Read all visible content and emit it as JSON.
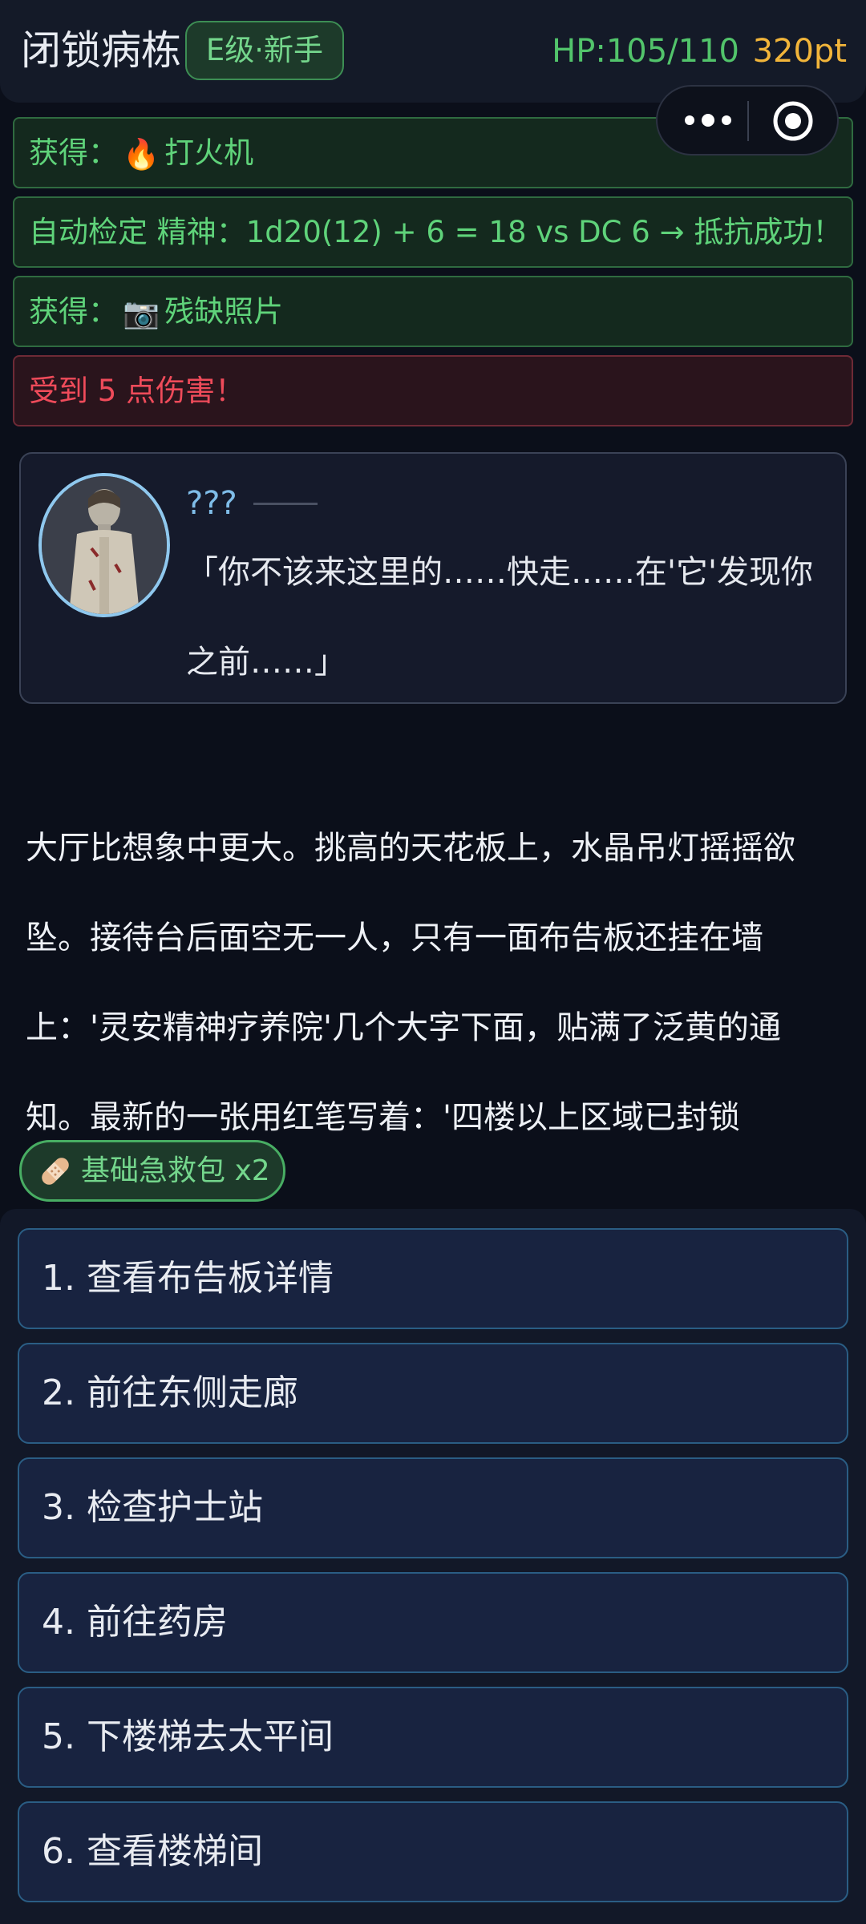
{
  "header": {
    "title": "闭锁病栋",
    "level_badge": "E级·新手",
    "hp": "HP:105/110",
    "points": "320pt"
  },
  "capsule": {
    "more_icon": "more-dots-icon",
    "close_icon": "record-close-icon"
  },
  "notifications": [
    {
      "type": "success",
      "prefix": "获得：",
      "icon": "fire-icon",
      "emoji": "🔥",
      "text": "打火机"
    },
    {
      "type": "success",
      "prefix": "",
      "icon": "",
      "emoji": "",
      "text": "自动检定 精神：1d20(12) + 6 = 18 vs DC 6 → 抵抗成功！"
    },
    {
      "type": "success",
      "prefix": "获得：",
      "icon": "camera-icon",
      "emoji": "📷",
      "text": "残缺照片"
    },
    {
      "type": "danger",
      "prefix": "",
      "icon": "",
      "emoji": "",
      "text": "受到 5 点伤害！"
    }
  ],
  "dialog": {
    "speaker": "???",
    "avatar": "nurse-avatar",
    "text": "「你不该来这里的……快走……在'它'发现你之前……」"
  },
  "narrative": {
    "text": "大厅比想象中更大。挑高的天花板上，水晶吊灯摇摇欲坠。接待台后面空无一人，只有一面布告板还挂在墙上：'灵安精神疗养院'几个大字下面，贴满了泛黄的通知。最新的一张用红笔写着：'四楼以上区域已封锁"
  },
  "item_chip": {
    "icon": "bandage-icon",
    "label": "基础急救包 x2"
  },
  "choices": [
    {
      "label": "1. 查看布告板详情"
    },
    {
      "label": "2. 前往东侧走廊"
    },
    {
      "label": "3. 检查护士站"
    },
    {
      "label": "4. 前往药房"
    },
    {
      "label": "5. 下楼梯去太平间"
    },
    {
      "label": "6. 查看楼梯间"
    }
  ],
  "colors": {
    "background": "#0b0f1a",
    "accent_green": "#5fd37a",
    "danger_red": "#ef4b5a",
    "points_gold": "#f2b53a",
    "speaker_blue": "#7fbde8"
  }
}
